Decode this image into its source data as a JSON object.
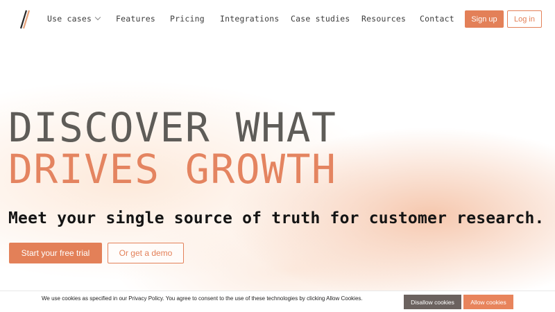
{
  "nav": {
    "logo_icon": "slash-logo-icon",
    "items": [
      {
        "label": "Use cases",
        "has_dropdown": true
      },
      {
        "label": "Features"
      },
      {
        "label": "Pricing"
      },
      {
        "label": "Integrations"
      },
      {
        "label": "Case studies"
      },
      {
        "label": "Resources"
      },
      {
        "label": "Contact"
      }
    ],
    "signup_label": "Sign up",
    "login_label": "Log in"
  },
  "hero": {
    "headline_line1": "DISCOVER WHAT",
    "headline_line2": "DRIVES GROWTH",
    "subheadline": "Meet your single source of truth for customer research.",
    "primary_cta": "Start your free trial",
    "secondary_cta": "Or get a demo"
  },
  "cookie_banner": {
    "text": "We use cookies as specified in our Privacy Policy. You agree to consent to the use of these technologies by clicking Allow Cookies.",
    "disallow_label": "Disallow cookies",
    "allow_label": "Allow cookies"
  },
  "colors": {
    "accent": "#e38058",
    "headline_gray": "#5e5c58",
    "headline_orange": "#e48460",
    "disallow_bg": "#6b625f"
  }
}
